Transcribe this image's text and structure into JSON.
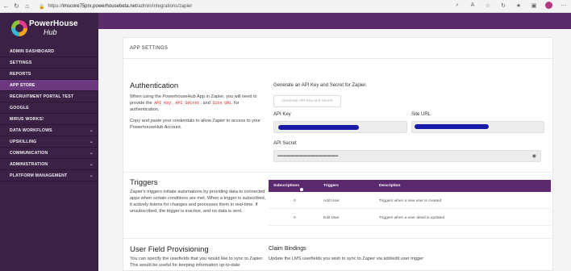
{
  "browser": {
    "url_prefix": "https://",
    "url_host": "lmscore75prx.powerhousebeta.net",
    "url_path": "/admin/integrations/zapier"
  },
  "logo": {
    "text": "PowerHouse",
    "sub": "Hub"
  },
  "menu": [
    {
      "label": "ADMIN DASHBOARD",
      "chevron": false
    },
    {
      "label": "SETTINGS",
      "chevron": false
    },
    {
      "label": "REPORTS",
      "chevron": false
    },
    {
      "label": "APP STORE",
      "chevron": false,
      "active": true
    },
    {
      "label": "RECRUITMENT PORTAL TEST",
      "chevron": false
    },
    {
      "label": "GOOGLE",
      "chevron": false
    },
    {
      "label": "MIRUS WORKS!",
      "chevron": false
    },
    {
      "label": "DATA WORKFLOWS",
      "chevron": true
    },
    {
      "label": "UPSKILLING",
      "chevron": true
    },
    {
      "label": "COMMUNICATION",
      "chevron": true
    },
    {
      "label": "ADMINISTRATION",
      "chevron": true
    },
    {
      "label": "PLATFORM MANAGEMENT",
      "chevron": true
    }
  ],
  "card_header": "APP SETTINGS",
  "auth": {
    "title": "Authentication",
    "text1a": "When using the PowerhouseHub App in Zapier, you will need to",
    "text1b_pre": "provide the",
    "key1": "API Key",
    "key2": "API Secret",
    "text1b_mid": ", and",
    "key3": "Site URL",
    "text1b_post": "for authentication.",
    "text2": "Copy and paste your credentials to allow Zapier to access to your PowerhouseHub Account.",
    "gen_label": "Generate an API Key and Secret for Zapier.",
    "gen_button": "Generate API Key and Secret",
    "api_key_label": "API Key",
    "site_url_label": "Site URL",
    "api_secret_label": "API Secret",
    "api_secret_value": "••••••••••••••••••••••••••••••••••••••••••••••••••••••••••••"
  },
  "triggers": {
    "title": "Triggers",
    "text": "Zapier's triggers initiate automations by providing data to connected apps when certain conditions are met. When a trigger is subscribed, it actively listens for changes and processes them in real-time. If unsubscribed, the trigger is inactive, and no data is sent.",
    "columns": [
      "Subscriptions",
      "Triggers",
      "Description"
    ],
    "rows": [
      {
        "subs": "0",
        "trigger": "Add User",
        "desc": "Triggers when a new user is created"
      },
      {
        "subs": "0",
        "trigger": "Edit User",
        "desc": "Triggers when a user detail is updated"
      }
    ]
  },
  "user_field": {
    "title": "User Field Provisioning",
    "text": "You can specify the userfields that you would like to sync to Zapier. This would be useful for keeping information up-to-date",
    "claim_title": "Claim Bindings",
    "claim_text": "Update the LMS userfields you wish to sync to Zapier via add/edit user trigger"
  }
}
